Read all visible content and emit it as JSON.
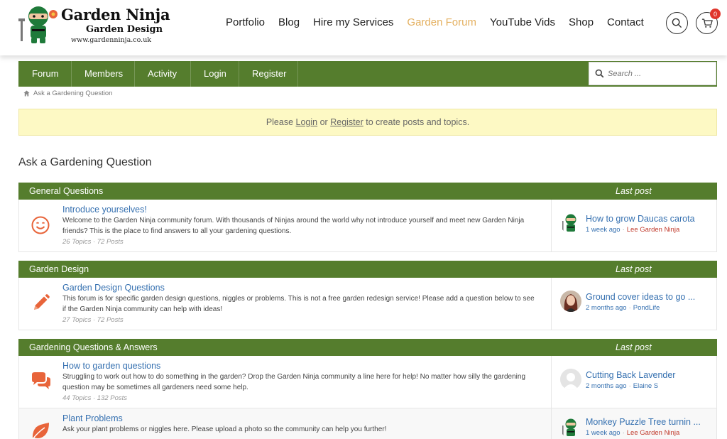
{
  "logo": {
    "title": "Garden Ninja",
    "subtitle": "Garden Design",
    "url": "www.gardenninja.co.uk"
  },
  "main_nav": [
    {
      "label": "Portfolio",
      "active": false
    },
    {
      "label": "Blog",
      "active": false
    },
    {
      "label": "Hire my Services",
      "active": false
    },
    {
      "label": "Garden Forum",
      "active": true
    },
    {
      "label": "YouTube Vids",
      "active": false
    },
    {
      "label": "Shop",
      "active": false
    },
    {
      "label": "Contact",
      "active": false
    }
  ],
  "cart": {
    "count": "0"
  },
  "forum_nav": {
    "items": [
      "Forum",
      "Members",
      "Activity",
      "Login",
      "Register"
    ],
    "search_placeholder": "Search ..."
  },
  "breadcrumb": {
    "current": "Ask a Gardening Question"
  },
  "notice": {
    "prefix": "Please",
    "login": "Login",
    "or": "or",
    "register": "Register",
    "suffix": "to create posts and topics."
  },
  "page_title": "Ask a Gardening Question",
  "categories": [
    {
      "name": "General Questions",
      "last_post_label": "Last post",
      "forums": [
        {
          "title": "Introduce yourselves!",
          "icon": "smiley-icon",
          "description": "Welcome to the Garden Ninja community forum. With thousands of Ninjas around the world why not introduce yourself and meet new Garden Ninja friends? This is the place to find answers to all your gardening questions.",
          "stats": "26 Topics · 72 Posts",
          "last_post": {
            "title": "How to grow Daucas carota",
            "time": "1 week ago",
            "author": "Lee Garden Ninja",
            "avatar": "ninja-avatar"
          }
        }
      ]
    },
    {
      "name": "Garden Design",
      "last_post_label": "Last post",
      "forums": [
        {
          "title": "Garden Design Questions",
          "icon": "pencil-icon",
          "description": "This forum is for specific garden design questions, niggles or problems. This is not a free garden redesign service! Please add a question below to see if the Garden Ninja community can help with ideas!",
          "stats": "27 Topics · 72 Posts",
          "last_post": {
            "title": "Ground cover ideas to go ...",
            "time": "2 months ago",
            "author": "PondLife",
            "avatar": "user-photo-avatar"
          }
        }
      ]
    },
    {
      "name": "Gardening Questions & Answers",
      "last_post_label": "Last post",
      "forums": [
        {
          "title": "How to garden questions",
          "icon": "chat-bubbles-icon",
          "description": "Struggling to work out how to do something in the garden? Drop the Garden Ninja community a line here for help! No matter how silly the gardening question may be sometimes all gardeners need some help.",
          "stats": "44 Topics · 132 Posts",
          "last_post": {
            "title": "Cutting Back Lavender",
            "time": "2 months ago",
            "author": "Elaine S",
            "avatar": "default-avatar"
          }
        },
        {
          "title": "Plant Problems",
          "icon": "leaf-icon",
          "description": "Ask your plant problems or niggles here. Please upload a photo so the community can help you further!",
          "stats": "",
          "last_post": {
            "title": "Monkey Puzzle Tree turnin ...",
            "time": "1 week ago",
            "author": "Lee Garden Ninja",
            "avatar": "ninja-avatar"
          }
        }
      ]
    }
  ],
  "colors": {
    "brand_green": "#557d2d",
    "active_nav": "#e4b060",
    "link_blue": "#3570b0",
    "admin_red": "#c0392b",
    "icon_orange": "#e8643a"
  }
}
